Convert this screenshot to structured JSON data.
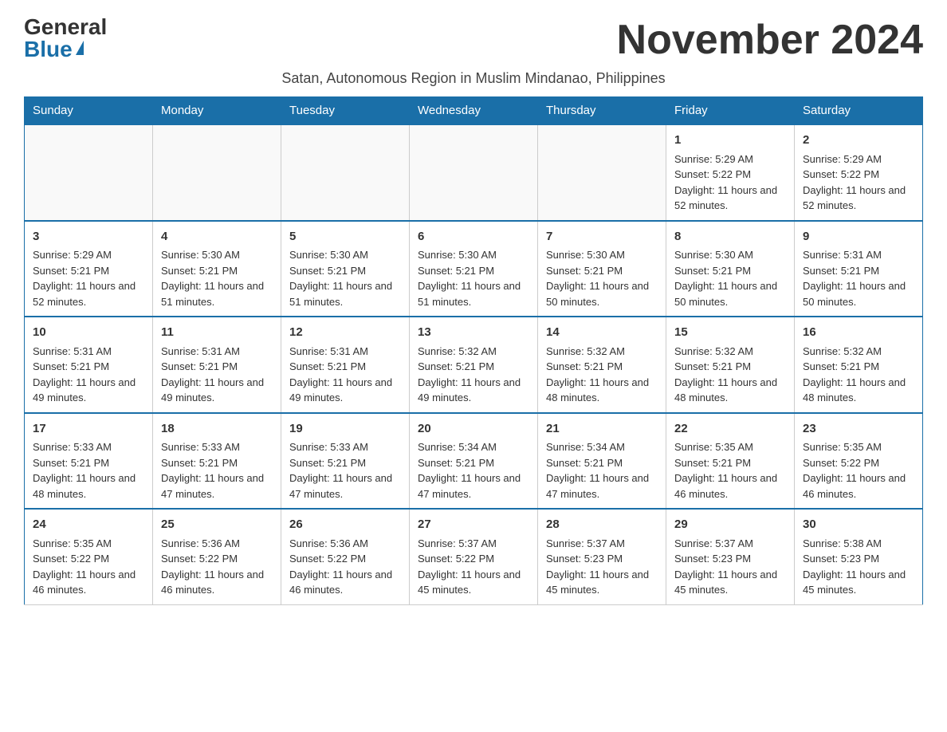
{
  "logo": {
    "general_text": "General",
    "blue_text": "Blue"
  },
  "title": "November 2024",
  "subtitle": "Satan, Autonomous Region in Muslim Mindanao, Philippines",
  "weekdays": [
    "Sunday",
    "Monday",
    "Tuesday",
    "Wednesday",
    "Thursday",
    "Friday",
    "Saturday"
  ],
  "weeks": [
    [
      {
        "day": "",
        "info": ""
      },
      {
        "day": "",
        "info": ""
      },
      {
        "day": "",
        "info": ""
      },
      {
        "day": "",
        "info": ""
      },
      {
        "day": "",
        "info": ""
      },
      {
        "day": "1",
        "info": "Sunrise: 5:29 AM\nSunset: 5:22 PM\nDaylight: 11 hours and 52 minutes."
      },
      {
        "day": "2",
        "info": "Sunrise: 5:29 AM\nSunset: 5:22 PM\nDaylight: 11 hours and 52 minutes."
      }
    ],
    [
      {
        "day": "3",
        "info": "Sunrise: 5:29 AM\nSunset: 5:21 PM\nDaylight: 11 hours and 52 minutes."
      },
      {
        "day": "4",
        "info": "Sunrise: 5:30 AM\nSunset: 5:21 PM\nDaylight: 11 hours and 51 minutes."
      },
      {
        "day": "5",
        "info": "Sunrise: 5:30 AM\nSunset: 5:21 PM\nDaylight: 11 hours and 51 minutes."
      },
      {
        "day": "6",
        "info": "Sunrise: 5:30 AM\nSunset: 5:21 PM\nDaylight: 11 hours and 51 minutes."
      },
      {
        "day": "7",
        "info": "Sunrise: 5:30 AM\nSunset: 5:21 PM\nDaylight: 11 hours and 50 minutes."
      },
      {
        "day": "8",
        "info": "Sunrise: 5:30 AM\nSunset: 5:21 PM\nDaylight: 11 hours and 50 minutes."
      },
      {
        "day": "9",
        "info": "Sunrise: 5:31 AM\nSunset: 5:21 PM\nDaylight: 11 hours and 50 minutes."
      }
    ],
    [
      {
        "day": "10",
        "info": "Sunrise: 5:31 AM\nSunset: 5:21 PM\nDaylight: 11 hours and 49 minutes."
      },
      {
        "day": "11",
        "info": "Sunrise: 5:31 AM\nSunset: 5:21 PM\nDaylight: 11 hours and 49 minutes."
      },
      {
        "day": "12",
        "info": "Sunrise: 5:31 AM\nSunset: 5:21 PM\nDaylight: 11 hours and 49 minutes."
      },
      {
        "day": "13",
        "info": "Sunrise: 5:32 AM\nSunset: 5:21 PM\nDaylight: 11 hours and 49 minutes."
      },
      {
        "day": "14",
        "info": "Sunrise: 5:32 AM\nSunset: 5:21 PM\nDaylight: 11 hours and 48 minutes."
      },
      {
        "day": "15",
        "info": "Sunrise: 5:32 AM\nSunset: 5:21 PM\nDaylight: 11 hours and 48 minutes."
      },
      {
        "day": "16",
        "info": "Sunrise: 5:32 AM\nSunset: 5:21 PM\nDaylight: 11 hours and 48 minutes."
      }
    ],
    [
      {
        "day": "17",
        "info": "Sunrise: 5:33 AM\nSunset: 5:21 PM\nDaylight: 11 hours and 48 minutes."
      },
      {
        "day": "18",
        "info": "Sunrise: 5:33 AM\nSunset: 5:21 PM\nDaylight: 11 hours and 47 minutes."
      },
      {
        "day": "19",
        "info": "Sunrise: 5:33 AM\nSunset: 5:21 PM\nDaylight: 11 hours and 47 minutes."
      },
      {
        "day": "20",
        "info": "Sunrise: 5:34 AM\nSunset: 5:21 PM\nDaylight: 11 hours and 47 minutes."
      },
      {
        "day": "21",
        "info": "Sunrise: 5:34 AM\nSunset: 5:21 PM\nDaylight: 11 hours and 47 minutes."
      },
      {
        "day": "22",
        "info": "Sunrise: 5:35 AM\nSunset: 5:21 PM\nDaylight: 11 hours and 46 minutes."
      },
      {
        "day": "23",
        "info": "Sunrise: 5:35 AM\nSunset: 5:22 PM\nDaylight: 11 hours and 46 minutes."
      }
    ],
    [
      {
        "day": "24",
        "info": "Sunrise: 5:35 AM\nSunset: 5:22 PM\nDaylight: 11 hours and 46 minutes."
      },
      {
        "day": "25",
        "info": "Sunrise: 5:36 AM\nSunset: 5:22 PM\nDaylight: 11 hours and 46 minutes."
      },
      {
        "day": "26",
        "info": "Sunrise: 5:36 AM\nSunset: 5:22 PM\nDaylight: 11 hours and 46 minutes."
      },
      {
        "day": "27",
        "info": "Sunrise: 5:37 AM\nSunset: 5:22 PM\nDaylight: 11 hours and 45 minutes."
      },
      {
        "day": "28",
        "info": "Sunrise: 5:37 AM\nSunset: 5:23 PM\nDaylight: 11 hours and 45 minutes."
      },
      {
        "day": "29",
        "info": "Sunrise: 5:37 AM\nSunset: 5:23 PM\nDaylight: 11 hours and 45 minutes."
      },
      {
        "day": "30",
        "info": "Sunrise: 5:38 AM\nSunset: 5:23 PM\nDaylight: 11 hours and 45 minutes."
      }
    ]
  ]
}
